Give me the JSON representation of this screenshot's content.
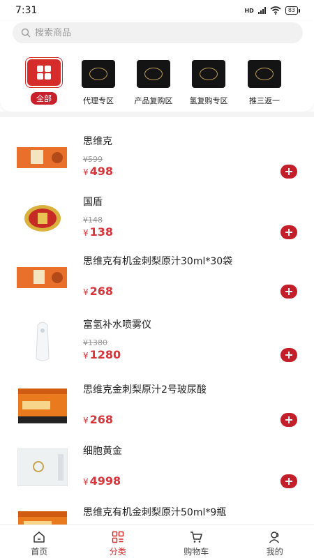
{
  "status": {
    "time": "7:31",
    "battery": "83",
    "network": "HD"
  },
  "search": {
    "placeholder": "搜索商品"
  },
  "categories": [
    {
      "label": "全部"
    },
    {
      "label": "代理专区"
    },
    {
      "label": "产品复购区"
    },
    {
      "label": "氢复购专区"
    },
    {
      "label": "推三返一"
    }
  ],
  "currency": "¥",
  "products": [
    {
      "name": "思维克",
      "old_price": "¥599",
      "price": "498"
    },
    {
      "name": "国盾",
      "old_price": "¥148",
      "price": "138"
    },
    {
      "name": "思维克有机金刺梨原汁30ml*30袋",
      "old_price": "",
      "price": "268"
    },
    {
      "name": "富氢补水喷雾仪",
      "old_price": "¥1380",
      "price": "1280"
    },
    {
      "name": "思维克金刺梨原汁2号玻尿酸",
      "old_price": "",
      "price": "268"
    },
    {
      "name": "细胞黄金",
      "old_price": "",
      "price": "4998"
    },
    {
      "name": "思维克有机金刺梨原汁50ml*9瓶",
      "old_price": "",
      "price": ""
    }
  ],
  "tabs": [
    {
      "label": "首页"
    },
    {
      "label": "分类"
    },
    {
      "label": "购物车"
    },
    {
      "label": "我的"
    }
  ],
  "colors": {
    "accent": "#d62b2b",
    "price": "#d8343b",
    "add_button": "#c41e2a"
  }
}
